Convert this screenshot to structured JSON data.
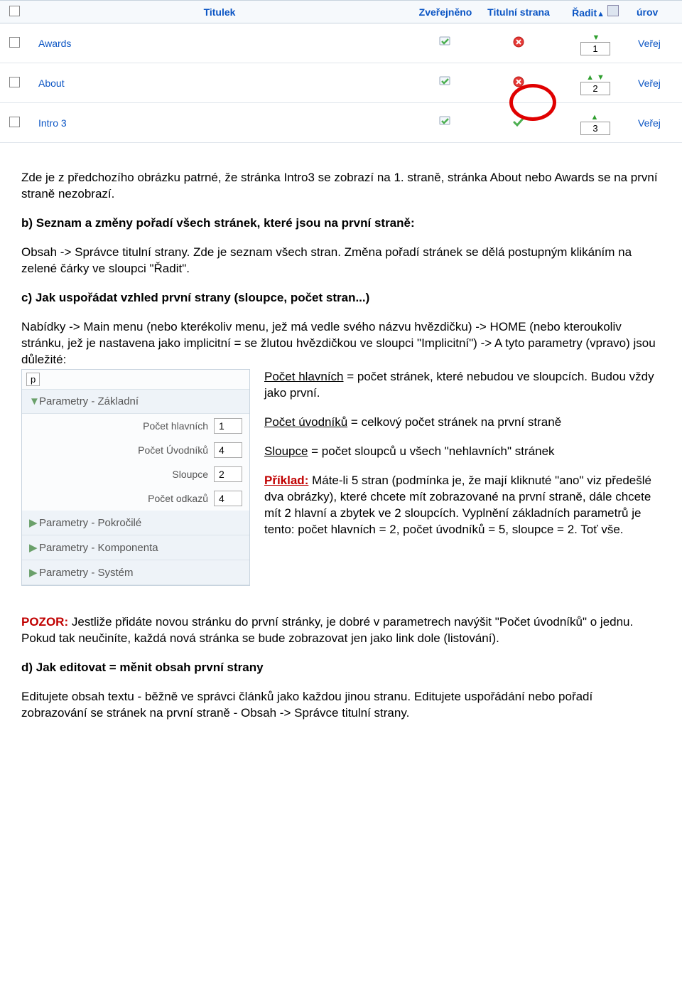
{
  "table": {
    "headers": {
      "title": "Titulek",
      "published": "Zveřejněno",
      "front": "Titulní strana",
      "order": "Řadit",
      "level": "úrov"
    },
    "level_value": "Veřej",
    "rows": [
      {
        "title": "Awards",
        "published": true,
        "front": "deny",
        "order": "1"
      },
      {
        "title": "About",
        "published": true,
        "front": "deny",
        "order": "2"
      },
      {
        "title": "Intro 3",
        "published": true,
        "front": "ok",
        "order": "3"
      }
    ]
  },
  "body": {
    "p1": "Zde je z předchozího obrázku patrné, že stránka Intro3 se zobrazí na 1. straně, stránka About nebo Awards se na první straně nezobrazí.",
    "b_heading": "b) Seznam a změny pořadí všech stránek, které jsou na první straně:",
    "b_text": "Obsah -> Správce titulní strany. Zde je seznam všech stran. Změna pořadí stránek se dělá postupným klikáním na zelené čárky ve sloupci \"Řadit\".",
    "c_heading": "c) Jak uspořádat vzhled první strany (sloupce, počet stran...)",
    "c_text": "Nabídky -> Main menu (nebo kterékoliv menu, jež má vedle svého názvu hvězdičku) -> HOME (nebo kteroukoliv stránku, jež je nastavena jako implicitní = se žlutou hvězdičkou ve sloupci \"Implicitní\") -> A tyto parametry (vpravo) jsou důležité:",
    "params": {
      "basic": "Parametry - Základní",
      "advanced": "Parametry - Pokročilé",
      "component": "Parametry - Komponenta",
      "system": "Parametry - Systém",
      "rows": [
        {
          "label": "Počet hlavních",
          "val": "1"
        },
        {
          "label": "Počet Úvodníků",
          "val": "4"
        },
        {
          "label": "Sloupce",
          "val": "2"
        },
        {
          "label": "Počet odkazů",
          "val": "4"
        }
      ]
    },
    "right": {
      "p_main_lead": "Počet hlavních",
      "p_main_rest": " = počet stránek, které nebudou ve sloupcích. Budou vždy jako první.",
      "p_intro_lead": "Počet úvodníků",
      "p_intro_rest": " = celkový počet stránek na první straně",
      "p_cols_lead": "Sloupce",
      "p_cols_rest": " = počet sloupců u všech \"nehlavních\" stránek",
      "p_ex_lead": "Příklad:",
      "p_ex_rest": " Máte-li 5 stran (podmínka je, že mají kliknuté \"ano\" viz předešlé dva obrázky), které chcete mít zobrazované na první straně, dále chcete mít 2 hlavní a zbytek ve 2 sloupcích. Vyplnění základních parametrů je tento: počet hlavních = 2, počet úvodníků = 5, sloupce = 2. Toť vše."
    },
    "pozor_lead": "POZOR:",
    "pozor_rest": " Jestliže přidáte novou stránku do první stránky, je dobré v parametrech navýšit \"Počet úvodníků\" o jednu. Pokud tak neučiníte, každá nová stránka se bude zobrazovat jen jako link dole (listování).",
    "d_heading": "d) Jak editovat = měnit obsah první strany",
    "d_text": "Editujete obsah textu - běžně ve správci článků jako každou jinou stranu. Editujete uspořádání nebo pořadí zobrazování se stránek na první straně - Obsah -> Správce titulní strany."
  }
}
